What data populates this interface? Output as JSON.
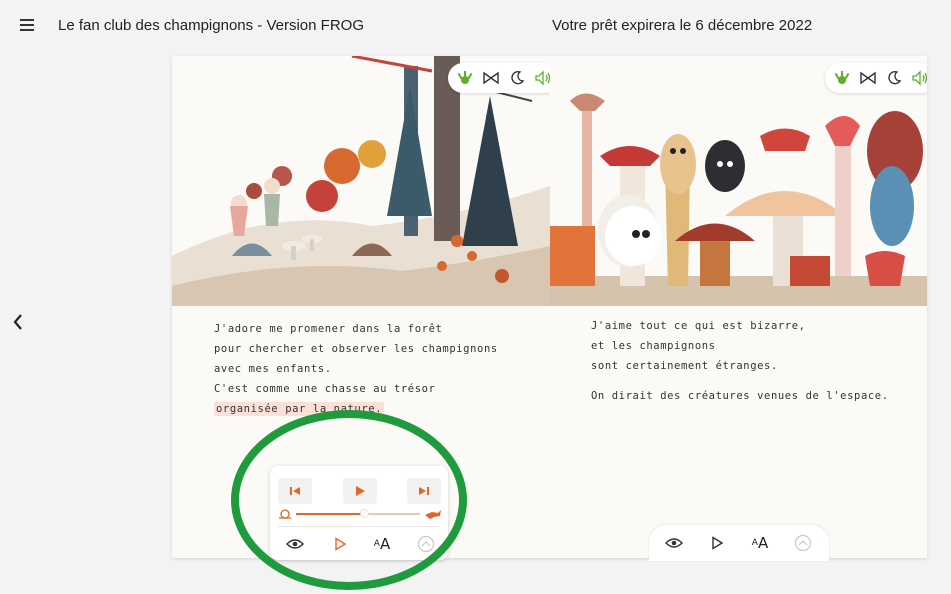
{
  "header": {
    "menu_icon": "hamburger-icon",
    "title": "Le fan club des champignons - Version FROG",
    "loan_notice": "Votre prêt expirera le 6 décembre 2022"
  },
  "nav": {
    "back_icon": "chevron-left-icon"
  },
  "left_page": {
    "lines": [
      "J'adore me promener dans la forêt",
      "pour chercher et observer les champignons",
      "avec mes enfants.",
      "C'est comme une chasse au trésor"
    ],
    "highlighted_line": "organisée par la nature."
  },
  "right_page": {
    "lines": [
      "J'aime tout ce qui est bizarre,",
      "et les champignons",
      "sont certainement étranges."
    ],
    "second_paragraph": "On dirait des créatures venues de l'espace."
  },
  "page_tools": [
    "frog-hand-icon",
    "bowtie-icon",
    "moon-icon",
    "speaker-icon"
  ],
  "audio_player": {
    "controls": [
      "skip-previous-icon",
      "play-icon",
      "skip-next-icon"
    ],
    "speed_slow_icon": "snail-icon",
    "speed_fast_icon": "fox-icon",
    "speed_level": 0.55,
    "tools": [
      "eye-icon",
      "play-outline-icon",
      "text-size-icon",
      "disabled-circle-icon"
    ],
    "text_size_small": "A",
    "text_size_large": "A"
  },
  "right_toolbar": {
    "tools": [
      "eye-icon",
      "play-outline-icon",
      "text-size-icon",
      "disabled-circle-icon"
    ],
    "text_size_small": "A",
    "text_size_large": "A"
  },
  "colors": {
    "accent": "#e2662a",
    "annotation": "#1f9a3c",
    "highlight": "#fbe0d8",
    "frog_green": "#5fae2e"
  }
}
